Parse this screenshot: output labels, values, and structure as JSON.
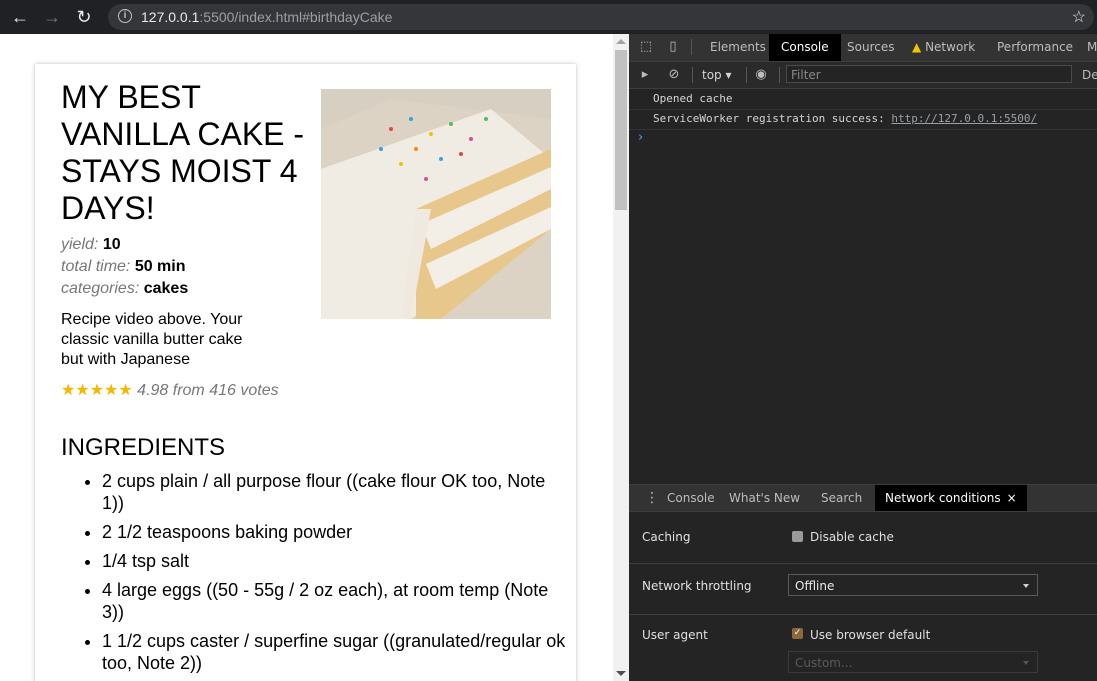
{
  "browser": {
    "url_host": "127.0.0.1",
    "url_rest": ":5500/index.html#birthdayCake",
    "back_icon": "←",
    "forward_icon": "→",
    "reload_icon": "↻",
    "info_icon": "i",
    "star_icon": "☆"
  },
  "recipe": {
    "title": "MY BEST VANILLA CAKE - STAYS MOIST 4 DAYS!",
    "meta": [
      {
        "key": "yield:",
        "value": "10"
      },
      {
        "key": "total time:",
        "value": "50 min"
      },
      {
        "key": "categories:",
        "value": "cakes"
      }
    ],
    "description": "Recipe video above. Your classic vanilla butter cake but with Japanese",
    "stars": "★★★★★",
    "rating_text": "4.98 from 416 votes",
    "ingredients_heading": "INGREDIENTS",
    "ingredients": [
      "2 cups plain / all purpose flour ((cake flour OK too, Note 1))",
      "2 1/2 teaspoons baking powder",
      "1/4 tsp salt",
      "4 large eggs ((50 - 55g / 2 oz each), at room temp (Note 3))",
      "1 1/2 cups caster / superfine sugar ((granulated/regular ok too, Note 2))"
    ]
  },
  "devtools": {
    "tabs": [
      "Elements",
      "Console",
      "Sources",
      "Network",
      "Performance",
      "M"
    ],
    "active_tab": "Console",
    "context": "top",
    "filter_placeholder": "Filter",
    "default_levels": "De",
    "console_lines": [
      {
        "text": "Opened cache"
      },
      {
        "text": "ServiceWorker registration success: ",
        "link": "http://127.0.0.1:5500/"
      }
    ],
    "prompt": "›",
    "drawer_tabs": [
      "Console",
      "What's New",
      "Search",
      "Network conditions"
    ],
    "drawer_close": "×",
    "network_conditions": {
      "caching_label": "Caching",
      "disable_cache_label": "Disable cache",
      "disable_cache_checked": false,
      "throttling_label": "Network throttling",
      "throttling_value": "Offline",
      "user_agent_label": "User agent",
      "use_browser_default_label": "Use browser default",
      "use_browser_default_checked": true,
      "custom_placeholder": "Custom..."
    }
  }
}
